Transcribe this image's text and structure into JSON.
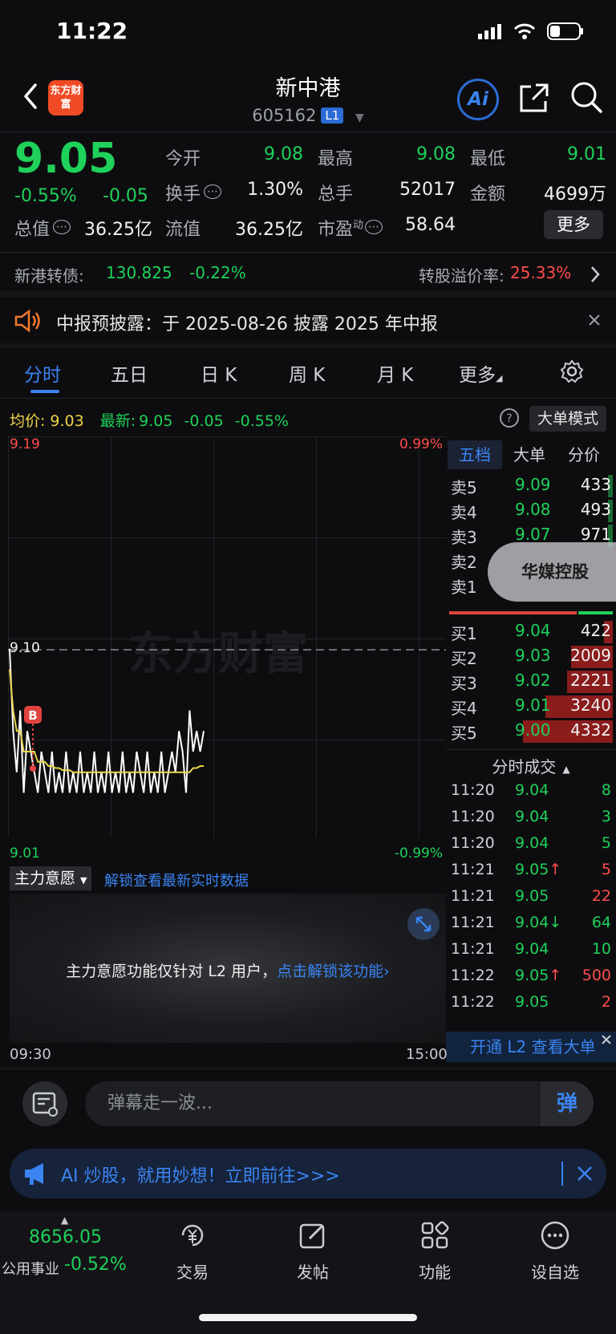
{
  "status_bar": {
    "time": "11:22"
  },
  "header": {
    "brand_logo_text": "东方财富",
    "stock_name": "新中港",
    "stock_code": "605162",
    "level_badge": "L1",
    "ai_label": "Ai"
  },
  "quote": {
    "price": "9.05",
    "change_pct": "-0.55%",
    "change_val": "-0.05",
    "fields": {
      "open_label": "今开",
      "open": "9.08",
      "high_label": "最高",
      "high": "9.08",
      "low_label": "最低",
      "low": "9.01",
      "turnover_label": "换手",
      "turnover": "1.30%",
      "volume_label": "总手",
      "volume": "52017",
      "amount_label": "金额",
      "amount": "4699万",
      "mktcap_label": "总值",
      "mktcap": "36.25亿",
      "float_label": "流值",
      "float": "36.25亿",
      "pe_label": "市盈",
      "pe_sup": "动",
      "pe": "58.64"
    },
    "more_button": "更多"
  },
  "bond": {
    "label": "新港转债:",
    "price": "130.825",
    "change": "-0.22%",
    "premium_label": "转股溢价率:",
    "premium": "25.33%"
  },
  "notice": {
    "text": "中报预披露：于 2025-08-26 披露 2025 年中报"
  },
  "tabs": [
    "分时",
    "五日",
    "日 K",
    "周 K",
    "月 K",
    "更多"
  ],
  "summary": {
    "avg_label": "均价:",
    "avg": "9.03",
    "latest_label": "最新:",
    "latest": "9.05",
    "latest_chg": "-0.05",
    "latest_pct": "-0.55%",
    "bigorder_button": "大单模式"
  },
  "chart_axes": {
    "y_top": "9.19",
    "y_mid": "9.10",
    "y_bottom": "9.01",
    "pct_top": "0.99%",
    "pct_bottom": "-0.99%",
    "t_start": "09:30",
    "t_end": "15:00",
    "watermark": "东方财富",
    "marker": "B"
  },
  "chart_data": {
    "type": "line",
    "title": "",
    "ylim": [
      9.01,
      9.19
    ],
    "reference": 9.1,
    "series": [
      {
        "name": "价格",
        "color": "#ffffff",
        "values": [
          9.09,
          9.05,
          9.03,
          9.06,
          9.02,
          9.05,
          9.04,
          9.03,
          9.02,
          9.04,
          9.03,
          9.02,
          9.04,
          9.02,
          9.03,
          9.02,
          9.04,
          9.02,
          9.03,
          9.02,
          9.04,
          9.02,
          9.03,
          9.02,
          9.04,
          9.02,
          9.03,
          9.02,
          9.04,
          9.02,
          9.03,
          9.02,
          9.04,
          9.02,
          9.03,
          9.02,
          9.04,
          9.03,
          9.02,
          9.04,
          9.02,
          9.03,
          9.02,
          9.04,
          9.02,
          9.03,
          9.04,
          9.03,
          9.05,
          9.04,
          9.02,
          9.06,
          9.04,
          9.05,
          9.04,
          9.05
        ]
      },
      {
        "name": "均价",
        "color": "#e8d74a",
        "values": [
          9.08,
          9.06,
          9.05,
          9.05,
          9.04,
          9.04,
          9.04,
          9.04,
          9.035,
          9.035,
          9.035,
          9.033,
          9.033,
          9.032,
          9.032,
          9.031,
          9.031,
          9.031,
          9.03,
          9.03,
          9.03,
          9.03,
          9.03,
          9.03,
          9.03,
          9.03,
          9.03,
          9.03,
          9.03,
          9.03,
          9.03,
          9.03,
          9.03,
          9.03,
          9.03,
          9.03,
          9.03,
          9.03,
          9.03,
          9.03,
          9.03,
          9.03,
          9.03,
          9.03,
          9.03,
          9.03,
          9.03,
          9.03,
          9.03,
          9.03,
          9.03,
          9.03,
          9.032,
          9.032,
          9.033,
          9.033
        ]
      }
    ]
  },
  "order_book": {
    "tabs": [
      "五档",
      "大单",
      "分价"
    ],
    "asks": [
      {
        "label": "卖5",
        "price": "9.09",
        "qty": "433"
      },
      {
        "label": "卖4",
        "price": "9.08",
        "qty": "493"
      },
      {
        "label": "卖3",
        "price": "9.07",
        "qty": "971"
      },
      {
        "label": "卖2",
        "price": "",
        "qty": ""
      },
      {
        "label": "卖1",
        "price": "",
        "qty": ""
      }
    ],
    "bids": [
      {
        "label": "买1",
        "price": "9.04",
        "qty": "422",
        "level": 0.1
      },
      {
        "label": "买2",
        "price": "9.03",
        "qty": "2009",
        "level": 0.46
      },
      {
        "label": "买3",
        "price": "9.02",
        "qty": "2221",
        "level": 0.51
      },
      {
        "label": "买4",
        "price": "9.01",
        "qty": "3240",
        "level": 0.75
      },
      {
        "label": "买5",
        "price": "9.00",
        "qty": "4332",
        "level": 1.0
      }
    ],
    "buy_ratio": 0.78,
    "floating_tag": "华媒控股"
  },
  "trades": {
    "header": "分时成交",
    "rows": [
      {
        "time": "11:20",
        "price": "9.04",
        "vol": "8",
        "vol_color": "green",
        "arrow": ""
      },
      {
        "time": "11:20",
        "price": "9.04",
        "vol": "3",
        "vol_color": "green",
        "arrow": ""
      },
      {
        "time": "11:20",
        "price": "9.04",
        "vol": "5",
        "vol_color": "green",
        "arrow": ""
      },
      {
        "time": "11:21",
        "price": "9.05",
        "vol": "5",
        "vol_color": "red",
        "arrow": "↑"
      },
      {
        "time": "11:21",
        "price": "9.05",
        "vol": "22",
        "vol_color": "red",
        "arrow": ""
      },
      {
        "time": "11:21",
        "price": "9.04",
        "vol": "64",
        "vol_color": "green",
        "arrow": "↓"
      },
      {
        "time": "11:21",
        "price": "9.04",
        "vol": "10",
        "vol_color": "green",
        "arrow": ""
      },
      {
        "time": "11:22",
        "price": "9.05",
        "vol": "500",
        "vol_color": "red",
        "arrow": "↑"
      },
      {
        "time": "11:22",
        "price": "9.05",
        "vol": "2",
        "vol_color": "red",
        "arrow": ""
      }
    ],
    "l2_banner": "开通 L2 查看大单"
  },
  "main_force": {
    "tab": "主力意愿",
    "unlock_link": "解锁查看最新实时数据",
    "message": "主力意愿功能仅针对 L2 用户，",
    "message_link": "点击解锁该功能"
  },
  "danmaku": {
    "placeholder": "弹幕走一波...",
    "send_label": "弹"
  },
  "promo": {
    "text": "AI 炒股，就用妙想！立即前往>>>"
  },
  "bottom_nav": {
    "index_value": "8656.05",
    "index_name": "公用事业",
    "index_change": "-0.52%",
    "items": [
      "交易",
      "发帖",
      "功能",
      "设自选"
    ]
  },
  "colors": {
    "up": "#ff4d4d",
    "down": "#1fd15a",
    "accent": "#3a84f2",
    "avg_line": "#e8d74a"
  }
}
